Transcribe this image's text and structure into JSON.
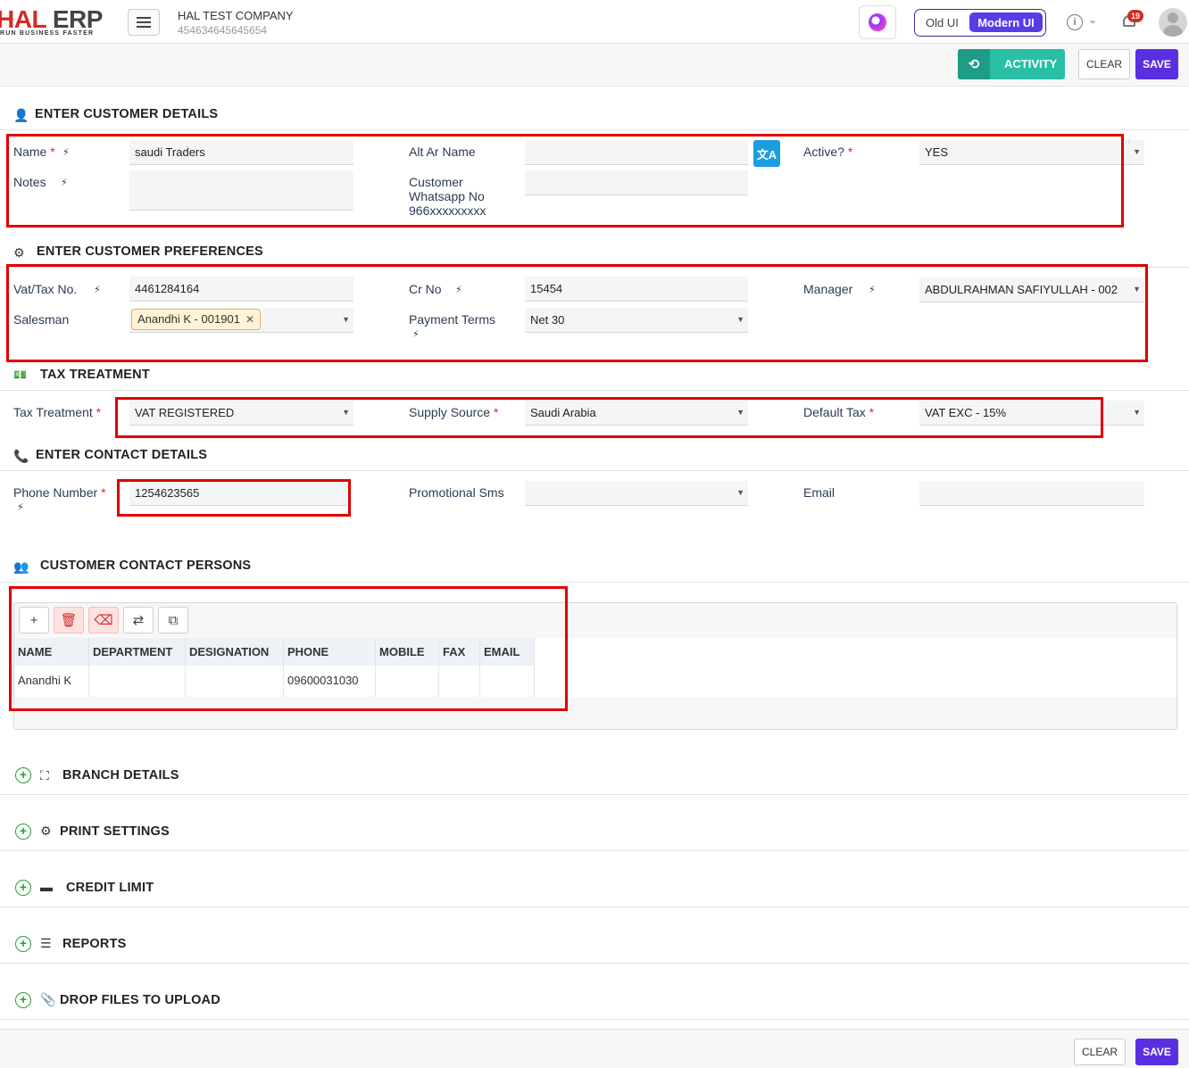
{
  "header": {
    "logo_main_a": "HAL",
    "logo_main_b": "ERP",
    "logo_tagline": "RUN BUSINESS FASTER",
    "company_name": "HAL TEST COMPANY",
    "company_code": "454634645645654",
    "old_ui_label": "Old UI",
    "modern_ui_label": "Modern UI",
    "info_glyph": "i",
    "notification_count": "19"
  },
  "actions": {
    "activity_label": "ACTIVITY",
    "clear_label": "CLEAR",
    "save_label": "SAVE"
  },
  "customer_details": {
    "title": "ENTER CUSTOMER DETAILS",
    "name_label": "Name",
    "name_value": "saudi Traders",
    "notes_label": "Notes",
    "notes_value": "",
    "alt_ar_name_label": "Alt Ar Name",
    "alt_ar_name_value": "",
    "translate_glyph": "文A",
    "whatsapp_label_line1": "Customer",
    "whatsapp_label_line2": "Whatsapp No",
    "whatsapp_label_line3": "966xxxxxxxxx",
    "whatsapp_value": "",
    "active_label": "Active?",
    "active_value": "YES"
  },
  "preferences": {
    "title": "ENTER CUSTOMER PREFERENCES",
    "vat_label": "Vat/Tax No.",
    "vat_value": "4461284164",
    "cr_label": "Cr No",
    "cr_value": "15454",
    "manager_label": "Manager",
    "manager_value": "ABDULRAHMAN SAFIYULLAH - 002",
    "salesman_label": "Salesman",
    "salesman_chip": "Anandhi K - 001901",
    "payment_terms_label": "Payment Terms",
    "payment_terms_value": "Net 30"
  },
  "tax": {
    "title": "TAX TREATMENT",
    "treatment_label": "Tax Treatment",
    "treatment_value": "VAT REGISTERED",
    "supply_source_label": "Supply Source",
    "supply_source_value": "Saudi Arabia",
    "default_tax_label": "Default Tax",
    "default_tax_value": "VAT EXC - 15%"
  },
  "contact": {
    "title": "ENTER CONTACT DETAILS",
    "phone_label": "Phone Number",
    "phone_value": "1254623565",
    "promo_sms_label": "Promotional Sms",
    "promo_sms_value": "",
    "email_label": "Email",
    "email_value": ""
  },
  "contact_persons": {
    "title": "CUSTOMER CONTACT PERSONS",
    "columns": [
      "NAME",
      "DEPARTMENT",
      "DESIGNATION",
      "PHONE",
      "MOBILE",
      "FAX",
      "EMAIL"
    ],
    "rows": [
      [
        "Anandhi K",
        "",
        "",
        "09600031030",
        "",
        "",
        ""
      ]
    ]
  },
  "collapsibles": {
    "branch": "BRANCH DETAILS",
    "print": "PRINT SETTINGS",
    "credit": "CREDIT LIMIT",
    "reports": "REPORTS",
    "files": "DROP FILES TO UPLOAD"
  }
}
